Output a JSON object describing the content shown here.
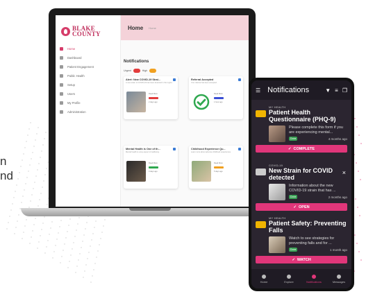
{
  "left_text": [
    "n",
    "nd"
  ],
  "desktop": {
    "logo": [
      "BLAKE",
      "COUNTY"
    ],
    "nav": [
      "Home",
      "Dashboard",
      "Patient Engagement",
      "Public Health",
      "Setup",
      "Users",
      "My Profile",
      "Administration"
    ],
    "header": {
      "title": "Home",
      "crumb": "Home"
    },
    "notifications_title": "Notifications",
    "legend": {
      "urgent": "Urgent",
      "high": "High"
    },
    "cards": [
      {
        "title": "Alert: New COVID-19 Strai...",
        "text": "A new strain of COVID-19 has been detected in the region.",
        "meta": "Read More",
        "time": "2 days ago",
        "status_color": "#e23c3c"
      },
      {
        "title": "Referral Accepted",
        "text": "Your referral has been accepted.",
        "meta": "Read More",
        "time": "1 hour ago",
        "status_color": "#3a4fd5"
      },
      {
        "title": "Mental Health is One of th...",
        "text": "Mental health is a key aspect of wellbeing.",
        "meta": "Read More",
        "time": "3 days ago",
        "status_color": "#2fa84f"
      },
      {
        "title": "Childhood Experience Qu...",
        "text": "Learn more about adverse childhood experiences.",
        "meta": "Read More",
        "time": "5 days ago",
        "status_color": "#f0a020"
      }
    ]
  },
  "phone": {
    "title": "Notifications",
    "cards": [
      {
        "category": "MY HEALTH",
        "title": "Patient Health Questionnaire (PHQ-9)",
        "desc": "Please complete this form if you are experiencing mental...",
        "badge": "Done",
        "time": "4 months ago",
        "button": "COMPLETE"
      },
      {
        "category": "COVID-19",
        "title": "New Strain for COVID detected",
        "desc": "Information about the new COVID-19 strain that has ...",
        "badge": "Done",
        "time": "2 months ago",
        "button": "OPEN"
      },
      {
        "category": "MY HEALTH",
        "title": "Patient Safety: Preventing Falls",
        "desc": "Watch to see strategies for preventing falls and for ...",
        "badge": "Done",
        "time": "1 month ago",
        "button": "WATCH"
      }
    ],
    "nav": [
      "Home",
      "Explore",
      "Notifications",
      "Messages"
    ]
  }
}
